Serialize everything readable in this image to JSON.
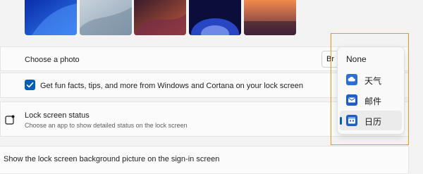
{
  "colors": {
    "accent": "#005fb8",
    "highlight_frame": "#f7941d"
  },
  "photos_row": {
    "label": "Choose a photo",
    "browse_label": "Br"
  },
  "checkbox_row": {
    "checked": true,
    "label": "Get fun facts, tips, and more from Windows and Cortana on your lock screen"
  },
  "status_row": {
    "title": "Lock screen status",
    "subtitle": "Choose an app to show detailed status on the lock screen",
    "icon": "lock-screen-status-icon"
  },
  "signin_row": {
    "label": "Show the lock screen background picture on the sign-in screen"
  },
  "dropdown": {
    "items": [
      {
        "label": "None",
        "icon": ""
      },
      {
        "label": "天气",
        "icon": "weather-icon"
      },
      {
        "label": "邮件",
        "icon": "mail-icon"
      },
      {
        "label": "日历",
        "icon": "calendar-icon",
        "selected": true
      }
    ]
  }
}
